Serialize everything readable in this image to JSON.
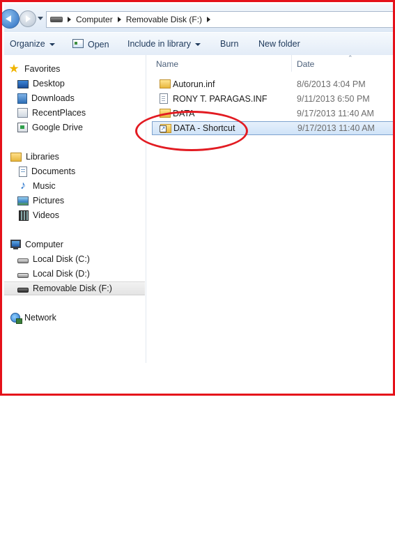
{
  "address_bar": {
    "breadcrumbs": [
      "Computer",
      "Removable Disk (F:)"
    ]
  },
  "toolbar": {
    "organize": "Organize",
    "open": "Open",
    "include_in_library": "Include in library",
    "burn": "Burn",
    "new_folder": "New folder"
  },
  "nav_pane": {
    "favorites": {
      "label": "Favorites",
      "items": [
        "Desktop",
        "Downloads",
        "RecentPlaces",
        "Google Drive"
      ]
    },
    "libraries": {
      "label": "Libraries",
      "items": [
        "Documents",
        "Music",
        "Pictures",
        "Videos"
      ]
    },
    "computer": {
      "label": "Computer",
      "items": [
        "Local Disk (C:)",
        "Local Disk (D:)",
        "Removable Disk (F:)"
      ],
      "selected": "Removable Disk (F:)"
    },
    "network": {
      "label": "Network"
    }
  },
  "file_list": {
    "columns": [
      "Name",
      "Date"
    ],
    "rows": [
      {
        "name": "Autorun.inf",
        "date": "8/6/2013 4:04 PM",
        "icon": "folder-icon"
      },
      {
        "name": "RONY T. PARAGAS.INF",
        "date": "9/11/2013 6:50 PM",
        "icon": "file-icon"
      },
      {
        "name": "DATA",
        "date": "9/17/2013 11:40 AM",
        "icon": "folder-icon"
      },
      {
        "name": "DATA - Shortcut",
        "date": "9/17/2013 11:40 AM",
        "icon": "shortcut-icon",
        "selected": true
      }
    ]
  },
  "colors": {
    "highlight_border": "#e5111a",
    "annotation_circle": "#e21b22",
    "selection": "#cfe3f8"
  }
}
